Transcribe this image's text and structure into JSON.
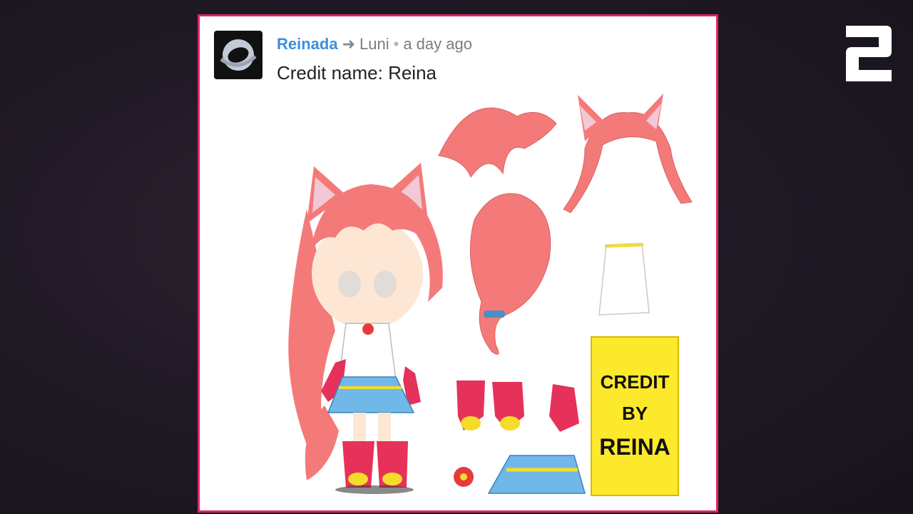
{
  "comment": {
    "author": "Reinada",
    "reply_to": "Luni",
    "separator": "•",
    "time": "a day ago",
    "text": "Credit name: Reina"
  },
  "artwork": {
    "credit_line1": "CREDIT",
    "credit_line2": "BY",
    "credit_line3": "REINA"
  },
  "rank_number": "2",
  "colors": {
    "card_border": "#e0245e",
    "author": "#3d8fd9",
    "hair": "#f47a7a",
    "skirt": "#6fb8e8",
    "credit_tag": "#fde92b"
  },
  "icons": {
    "reply": "reply-arrow-icon",
    "avatar": "planet-ring-icon"
  }
}
